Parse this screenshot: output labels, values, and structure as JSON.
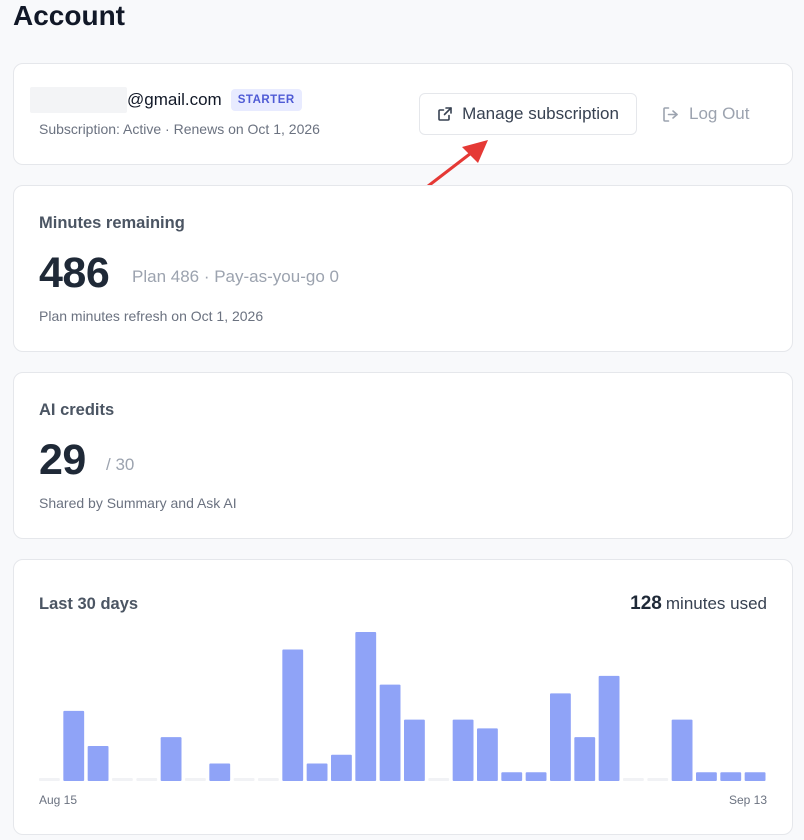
{
  "page": {
    "title": "Account"
  },
  "account": {
    "email_domain": "@gmail.com",
    "plan_badge": "STARTER",
    "subscription_status": "Subscription: Active · Renews on Oct 1, 2026",
    "manage_label": "Manage subscription",
    "logout_label": "Log Out"
  },
  "minutes": {
    "label": "Minutes remaining",
    "value": "486",
    "detail": "Plan 486 · Pay-as-you-go 0",
    "note": "Plan minutes refresh on Oct 1, 2026"
  },
  "credits": {
    "label": "AI credits",
    "value": "29",
    "total": "/ 30",
    "note": "Shared by Summary and Ask AI"
  },
  "usage": {
    "label": "Last 30 days",
    "total_value": "128",
    "total_unit": "minutes used"
  },
  "colors": {
    "bar": "#8fa3f7",
    "bar_empty": "#f1f2f5",
    "accent": "#4f5bd5",
    "annotation": "#e53935"
  },
  "chart_data": {
    "type": "bar",
    "x_start": "Aug 15",
    "x_end": "Sep 13",
    "ylim": [
      0,
      17
    ],
    "values": [
      0,
      8,
      4,
      0,
      0,
      5,
      0,
      2,
      0,
      0,
      15,
      2,
      3,
      17,
      11,
      7,
      0,
      7,
      6,
      1,
      1,
      10,
      5,
      12,
      0,
      0,
      7,
      1,
      1,
      1
    ]
  }
}
